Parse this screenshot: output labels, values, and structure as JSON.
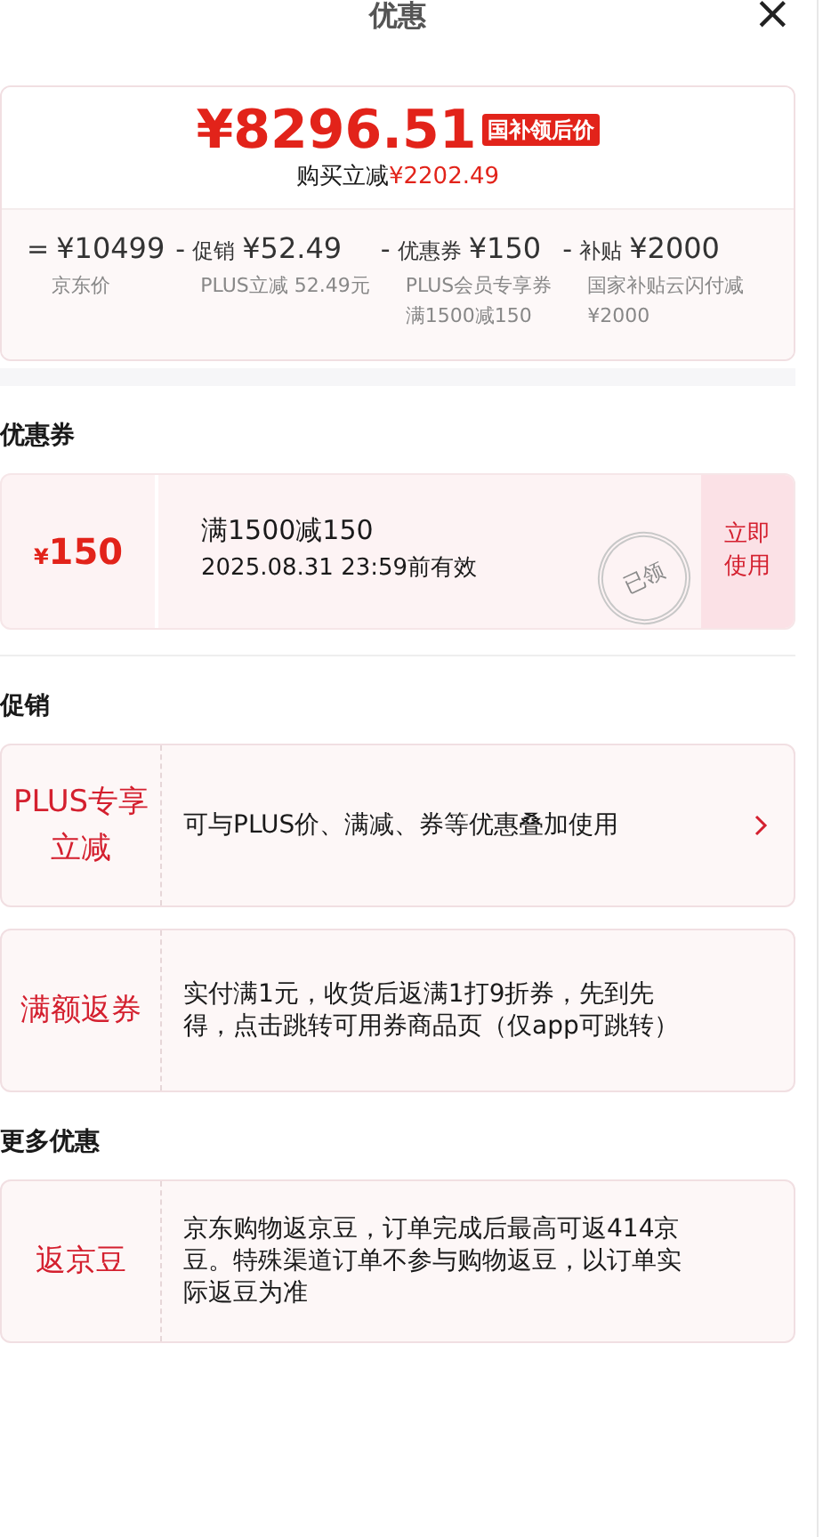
{
  "header": {
    "title": "优惠",
    "close": "×"
  },
  "price": {
    "amount": "¥8296.51",
    "tag": "国补领后价",
    "saving_label": "购买立减",
    "saving_amount": "¥2202.49"
  },
  "breakdown": [
    {
      "operator": "=",
      "amount": "¥10499",
      "notes": [
        "京东价"
      ]
    },
    {
      "operator": "-",
      "label": "促销",
      "amount": "¥52.49",
      "notes": [
        "PLUS立减 52.49元"
      ]
    },
    {
      "operator": "-",
      "label": "优惠券",
      "amount": "¥150",
      "notes": [
        "PLUS会员专享券",
        "满1500减150"
      ]
    },
    {
      "operator": "-",
      "label": "补贴",
      "amount": "¥2000",
      "notes": [
        "国家补贴云闪付减",
        "¥2000"
      ]
    }
  ],
  "coupon_section": {
    "title": "优惠券",
    "coupons": [
      {
        "currency": "¥",
        "value": "150",
        "condition": "满1500减150",
        "validity": "2025.08.31 23:59前有效",
        "stamp": "已领",
        "claimed": true,
        "button": "立即使用"
      }
    ]
  },
  "promo_section": {
    "title": "促销",
    "items": [
      {
        "tag": "PLUS专享立减",
        "text": "可与PLUS价、满减、券等优惠叠加使用",
        "arrow": true
      },
      {
        "tag": "满额返券",
        "text": "实付满1元，收货后返满1打9折券，先到先得，点击跳转可用券商品页（仅app可跳转）",
        "arrow": false
      }
    ]
  },
  "more_section": {
    "title": "更多优惠",
    "items": [
      {
        "tag": "返京豆",
        "text": "京东购物返京豆，订单完成后最高可返414京豆。特殊渠道订单不参与购物返豆，以订单实际返豆为准",
        "arrow": false
      }
    ]
  }
}
